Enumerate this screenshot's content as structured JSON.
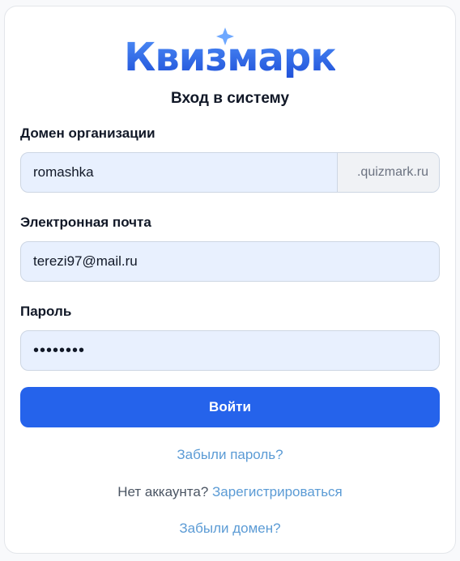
{
  "brand": {
    "logo_text": "Квизмарк",
    "logo_color_top": "#3b82f6",
    "logo_color_bottom": "#1e40af"
  },
  "form": {
    "title": "Вход в систему",
    "domain": {
      "label": "Домен организации",
      "value": "romashka",
      "suffix": ".quizmark.ru"
    },
    "email": {
      "label": "Электронная почта",
      "value": "terezi97@mail.ru"
    },
    "password": {
      "label": "Пароль",
      "value": "••••••••"
    },
    "submit_label": "Войти"
  },
  "links": {
    "forgot_password": "Забыли пароль?",
    "no_account_text": "Нет аккаунта?",
    "register": "Зарегистрироваться",
    "forgot_domain": "Забыли домен?"
  },
  "colors": {
    "primary": "#2563eb",
    "link": "#5b9bd5",
    "input_bg": "#e8f0fe"
  }
}
